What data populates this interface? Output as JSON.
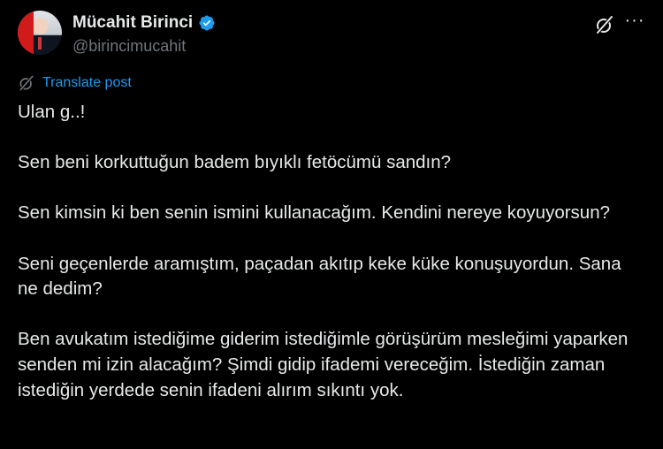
{
  "author": {
    "display_name": "Mücahit Birinci",
    "handle": "@birincimucahit",
    "avatar_icon": "profile-photo",
    "verified_color": "#1d9bf0"
  },
  "actions": {
    "grok_icon": "grok-icon",
    "more_icon": "more-options-icon",
    "more_label": "···"
  },
  "translate": {
    "label": "Translate post",
    "icon": "translate-icon",
    "color": "#1d9bf0"
  },
  "post": {
    "paragraphs": [
      "Ulan g..!",
      "Sen beni korkuttuğun badem bıyıklı fetöcümü sandın?",
      "Sen kimsin ki ben senin ismini kullanacağım. Kendini nereye koyuyorsun?",
      "Seni geçenlerde aramıştım, paçadan akıtıp keke küke konuşuyordun. Sana ne dedim?",
      "Ben avukatım istediğime giderim istediğimle görüşürüm mesleğimi yaparken senden mi izin alacağım? Şimdi gidip ifademi vereceğim. İstediğin zaman istediğin yerdede senin ifadeni alırım sıkıntı yok."
    ]
  }
}
